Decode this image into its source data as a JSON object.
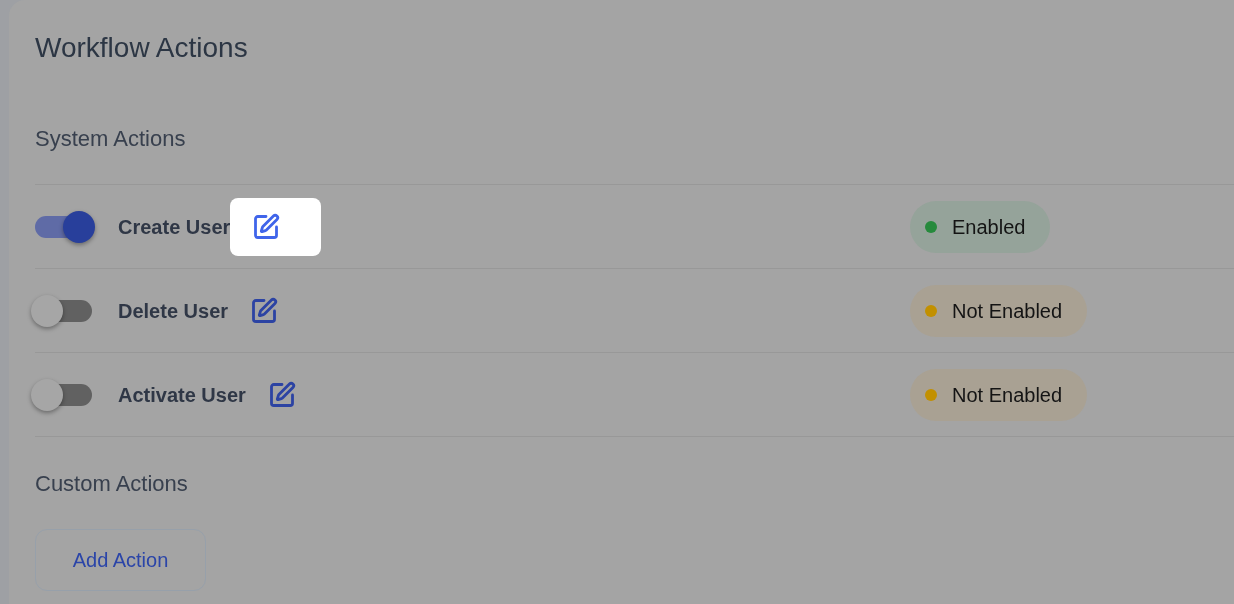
{
  "card": {
    "title": "Workflow Actions"
  },
  "system_actions": {
    "heading": "System Actions",
    "actions": [
      {
        "name": "Create User",
        "on": true,
        "highlighted": true,
        "status": {
          "label": "Enabled",
          "kind": "enabled",
          "color": "#268a3c"
        }
      },
      {
        "name": "Delete User",
        "on": false,
        "highlighted": false,
        "status": {
          "label": "Not Enabled",
          "kind": "not_enabled",
          "color": "#c29000"
        }
      },
      {
        "name": "Activate User",
        "on": false,
        "highlighted": false,
        "status": {
          "label": "Not Enabled",
          "kind": "not_enabled",
          "color": "#c29000"
        }
      }
    ]
  },
  "custom_actions": {
    "heading": "Custom Actions",
    "button": "Add Action"
  }
}
